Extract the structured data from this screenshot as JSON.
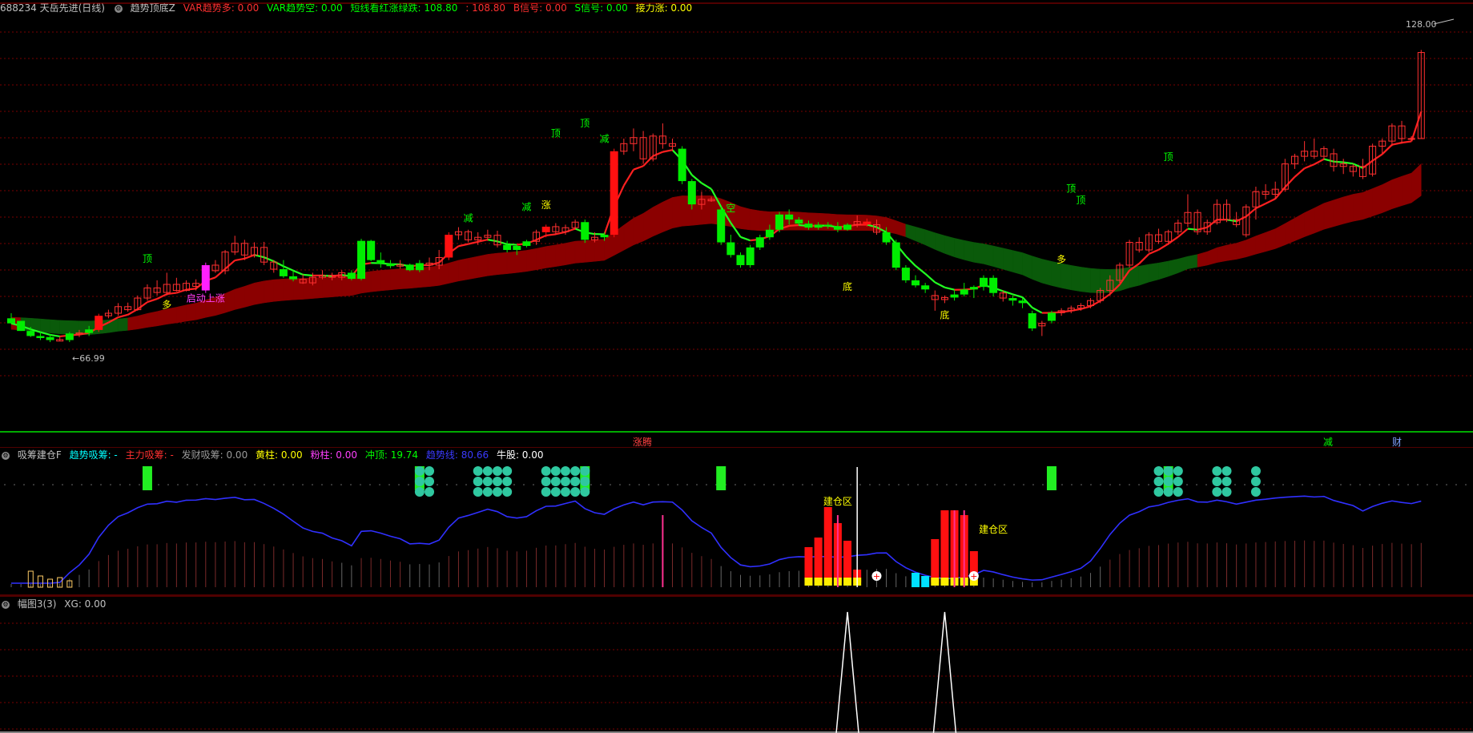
{
  "main_header": {
    "stock": "688234 天岳先进(日线)",
    "indicator": "趋势顶底Z",
    "items": [
      {
        "text": "VAR趋势多: 0.00",
        "color": "#ff3030"
      },
      {
        "text": "VAR趋势空: 0.00",
        "color": "#00ff00"
      },
      {
        "text": "短线看红涨绿跌: 108.80",
        "color": "#00ff00"
      },
      {
        "text": ": 108.80",
        "color": "#ff3030"
      },
      {
        "text": "B信号: 0.00",
        "color": "#ff3030"
      },
      {
        "text": "S信号: 0.00",
        "color": "#00ff00"
      },
      {
        "text": "接力涨: 0.00",
        "color": "#ffff00"
      }
    ]
  },
  "sub1_header": {
    "indicator": "吸筹建仓F",
    "items": [
      {
        "text": "趋势吸筹: -",
        "color": "#00ffff"
      },
      {
        "text": "主力吸筹: -",
        "color": "#ff3030"
      },
      {
        "text": "发财吸筹: 0.00",
        "color": "#9a9a9a"
      },
      {
        "text": "黄柱: 0.00",
        "color": "#ffff00"
      },
      {
        "text": "粉柱: 0.00",
        "color": "#ff40ff"
      },
      {
        "text": "冲顶: 19.74",
        "color": "#00ff00"
      },
      {
        "text": "趋势线: 80.66",
        "color": "#3a3aff"
      },
      {
        "text": "牛股: 0.00",
        "color": "#ffffff"
      }
    ]
  },
  "sub2_header": {
    "indicator": "幅图3(3)",
    "items": [
      {
        "text": "XG: 0.00",
        "color": "#c0c0c0"
      }
    ]
  },
  "chart_data": [
    {
      "type": "candlestick",
      "price_high_label": "128.00",
      "price_low_label": "66.99",
      "candles": [
        [
          71.5,
          72.5,
          70.5,
          70.5,
          "g"
        ],
        [
          71.0,
          71.0,
          69.0,
          69.0,
          "g"
        ],
        [
          69.0,
          69.8,
          67.8,
          68.0,
          "g"
        ],
        [
          68.0,
          68.8,
          67.2,
          67.6,
          "g"
        ],
        [
          67.8,
          68.4,
          66.8,
          67.2,
          "g"
        ],
        [
          67.0,
          67.8,
          66.99,
          67.3,
          "h"
        ],
        [
          67.2,
          68.8,
          66.8,
          68.5,
          "g"
        ],
        [
          68.4,
          69.2,
          67.8,
          68.6,
          "h"
        ],
        [
          68.6,
          70.0,
          68.0,
          69.3,
          "g"
        ],
        [
          69.2,
          72.4,
          68.8,
          72.0,
          "r"
        ],
        [
          72.0,
          73.2,
          71.5,
          72.5,
          "h"
        ],
        [
          72.5,
          74.5,
          72.0,
          73.8,
          "h"
        ],
        [
          73.8,
          74.6,
          72.8,
          73.2,
          "h"
        ],
        [
          73.2,
          76.0,
          73.0,
          75.5,
          "h"
        ],
        [
          75.5,
          78.2,
          75.0,
          77.5,
          "h"
        ],
        [
          77.5,
          79.0,
          76.0,
          76.6,
          "h"
        ],
        [
          76.6,
          80.5,
          76.0,
          78.2,
          "h"
        ],
        [
          78.2,
          79.5,
          76.8,
          77.0,
          "h"
        ],
        [
          77.0,
          79.0,
          76.8,
          78.4,
          "h"
        ],
        [
          78.4,
          79.2,
          77.0,
          77.8,
          "h"
        ],
        [
          77.0,
          82.5,
          76.5,
          82.0,
          "m"
        ],
        [
          82.0,
          83.0,
          80.5,
          80.9,
          "h"
        ],
        [
          80.9,
          85.0,
          80.2,
          84.6,
          "h"
        ],
        [
          84.6,
          87.8,
          84.0,
          86.3,
          "h"
        ],
        [
          86.3,
          87.0,
          83.0,
          84.0,
          "h"
        ],
        [
          84.0,
          86.5,
          83.5,
          85.5,
          "h"
        ],
        [
          85.5,
          86.6,
          82.0,
          82.6,
          "h"
        ],
        [
          82.6,
          83.0,
          80.5,
          81.2,
          "h"
        ],
        [
          81.2,
          83.0,
          79.5,
          79.8,
          "g"
        ],
        [
          79.8,
          81.0,
          78.8,
          79.2,
          "g"
        ],
        [
          79.2,
          80.2,
          78.3,
          78.5,
          "h"
        ],
        [
          78.5,
          80.5,
          78.0,
          79.6,
          "h"
        ],
        [
          79.6,
          81.0,
          79.2,
          80.0,
          "h"
        ],
        [
          80.0,
          80.5,
          79.0,
          79.6,
          "h"
        ],
        [
          79.6,
          81.0,
          79.0,
          80.5,
          "h"
        ],
        [
          80.5,
          81.0,
          79.0,
          79.3,
          "g"
        ],
        [
          79.3,
          87.2,
          79.0,
          86.8,
          "g"
        ],
        [
          86.8,
          87.0,
          82.8,
          83.0,
          "g"
        ],
        [
          83.0,
          84.5,
          81.5,
          82.3,
          "g"
        ],
        [
          82.3,
          83.0,
          81.4,
          81.8,
          "g"
        ],
        [
          81.8,
          83.0,
          81.3,
          82.1,
          "h"
        ],
        [
          82.1,
          82.3,
          80.8,
          81.0,
          "g"
        ],
        [
          81.0,
          83.0,
          80.6,
          82.4,
          "g"
        ],
        [
          82.4,
          83.5,
          81.0,
          82.0,
          "h"
        ],
        [
          82.0,
          85.0,
          81.2,
          83.5,
          "h"
        ],
        [
          83.5,
          88.5,
          83.0,
          88.0,
          "r"
        ],
        [
          88.0,
          89.5,
          87.0,
          88.6,
          "h"
        ],
        [
          88.6,
          89.0,
          86.5,
          87.0,
          "h"
        ],
        [
          87.0,
          88.5,
          86.0,
          87.5,
          "h"
        ],
        [
          87.5,
          89.0,
          86.8,
          87.9,
          "h"
        ],
        [
          87.9,
          88.8,
          85.5,
          86.0,
          "h"
        ],
        [
          86.0,
          86.8,
          84.5,
          85.0,
          "g"
        ],
        [
          85.0,
          86.0,
          84.0,
          85.8,
          "g"
        ],
        [
          85.8,
          87.0,
          85.5,
          86.7,
          "g"
        ],
        [
          86.7,
          89.0,
          86.0,
          88.5,
          "h"
        ],
        [
          88.5,
          90.0,
          87.5,
          89.6,
          "r"
        ],
        [
          89.6,
          90.3,
          88.0,
          88.6,
          "h"
        ],
        [
          88.6,
          90.0,
          88.0,
          89.4,
          "h"
        ],
        [
          89.4,
          91.0,
          89.0,
          90.5,
          "h"
        ],
        [
          90.5,
          91.0,
          86.4,
          87.0,
          "g"
        ],
        [
          87.0,
          88.5,
          86.5,
          87.5,
          "h"
        ],
        [
          87.5,
          88.5,
          86.8,
          88.0,
          "g"
        ],
        [
          88.0,
          105.0,
          87.5,
          104.5,
          "r"
        ],
        [
          104.5,
          107.0,
          103.8,
          106.0,
          "h"
        ],
        [
          106.0,
          109.0,
          104.5,
          107.2,
          "h"
        ],
        [
          107.2,
          108.5,
          102.0,
          103.0,
          "h"
        ],
        [
          103.0,
          108.0,
          102.5,
          107.5,
          "h"
        ],
        [
          107.5,
          110.0,
          105.0,
          106.0,
          "h"
        ],
        [
          106.0,
          107.0,
          104.5,
          105.5,
          "h"
        ],
        [
          105.0,
          105.5,
          98.0,
          98.6,
          "g"
        ],
        [
          98.6,
          99.0,
          93.0,
          94.0,
          "g"
        ],
        [
          94.0,
          96.5,
          93.0,
          95.0,
          "h"
        ],
        [
          95.0,
          95.5,
          94.5,
          94.7,
          "h"
        ],
        [
          93.0,
          93.5,
          86.0,
          86.5,
          "g"
        ],
        [
          86.5,
          88.0,
          83.5,
          84.0,
          "g"
        ],
        [
          84.0,
          84.5,
          81.5,
          82.0,
          "g"
        ],
        [
          82.0,
          86.0,
          81.5,
          85.5,
          "g"
        ],
        [
          85.5,
          88.0,
          85.0,
          87.5,
          "g"
        ],
        [
          87.5,
          90.0,
          87.0,
          89.0,
          "g"
        ],
        [
          89.0,
          92.5,
          88.5,
          92.0,
          "g"
        ],
        [
          92.0,
          93.0,
          90.0,
          91.0,
          "g"
        ],
        [
          91.0,
          91.5,
          89.8,
          90.2,
          "g"
        ],
        [
          90.2,
          90.8,
          89.0,
          89.4,
          "g"
        ],
        [
          89.4,
          90.5,
          89.0,
          90.0,
          "g"
        ],
        [
          90.0,
          90.5,
          89.2,
          89.7,
          "g"
        ],
        [
          89.7,
          90.5,
          88.5,
          89.0,
          "g"
        ],
        [
          89.0,
          90.3,
          88.8,
          90.0,
          "g"
        ],
        [
          90.0,
          91.8,
          89.5,
          90.6,
          "h"
        ],
        [
          90.6,
          91.2,
          89.6,
          90.0,
          "r"
        ],
        [
          90.0,
          91.0,
          88.0,
          88.5,
          "h"
        ],
        [
          88.5,
          89.5,
          86.0,
          86.5,
          "g"
        ],
        [
          86.5,
          87.0,
          81.0,
          81.5,
          "g"
        ],
        [
          81.5,
          82.0,
          78.5,
          79.0,
          "g"
        ],
        [
          79.0,
          80.0,
          77.6,
          78.0,
          "g"
        ],
        [
          78.0,
          78.5,
          76.5,
          77.2,
          "g"
        ],
        [
          76.0,
          77.0,
          73.0,
          75.2,
          "h"
        ],
        [
          75.2,
          76.0,
          74.5,
          75.6,
          "h"
        ],
        [
          75.6,
          77.0,
          75.0,
          76.2,
          "g"
        ],
        [
          76.2,
          78.5,
          75.8,
          77.2,
          "g"
        ],
        [
          77.2,
          78.0,
          75.5,
          77.7,
          "g"
        ],
        [
          77.7,
          80.0,
          77.0,
          79.5,
          "g"
        ],
        [
          79.5,
          80.0,
          75.8,
          76.5,
          "g"
        ],
        [
          76.5,
          77.0,
          74.8,
          75.5,
          "h"
        ],
        [
          75.5,
          76.0,
          74.0,
          75.0,
          "g"
        ],
        [
          75.0,
          75.5,
          73.5,
          74.5,
          "g"
        ],
        [
          72.5,
          73.0,
          69.0,
          69.5,
          "g"
        ],
        [
          70.0,
          71.0,
          68.0,
          70.5,
          "h"
        ],
        [
          71.0,
          73.0,
          70.5,
          72.6,
          "g"
        ],
        [
          72.6,
          73.5,
          72.0,
          73.0,
          "h"
        ],
        [
          73.0,
          74.0,
          72.5,
          73.5,
          "h"
        ],
        [
          73.5,
          74.5,
          73.0,
          74.0,
          "h"
        ],
        [
          74.0,
          75.5,
          73.5,
          75.0,
          "h"
        ],
        [
          75.0,
          77.5,
          74.5,
          77.0,
          "h"
        ],
        [
          77.0,
          80.0,
          76.0,
          79.0,
          "h"
        ],
        [
          79.0,
          82.5,
          78.5,
          82.0,
          "h"
        ],
        [
          82.0,
          87.0,
          81.5,
          86.5,
          "h"
        ],
        [
          86.5,
          87.5,
          84.5,
          85.0,
          "h"
        ],
        [
          85.0,
          88.5,
          84.5,
          88.0,
          "h"
        ],
        [
          88.0,
          89.2,
          86.2,
          86.7,
          "h"
        ],
        [
          86.7,
          89.0,
          86.0,
          88.6,
          "h"
        ],
        [
          88.6,
          91.0,
          88.0,
          90.3,
          "h"
        ],
        [
          90.3,
          96.0,
          89.5,
          92.4,
          "h"
        ],
        [
          92.4,
          93.0,
          88.0,
          88.6,
          "h"
        ],
        [
          88.6,
          91.0,
          88.0,
          90.4,
          "h"
        ],
        [
          90.4,
          95.0,
          90.0,
          94.0,
          "h"
        ],
        [
          94.0,
          95.0,
          90.5,
          91.0,
          "h"
        ],
        [
          91.0,
          92.5,
          89.5,
          90.0,
          "h"
        ],
        [
          88.0,
          94.0,
          87.5,
          93.5,
          "h"
        ],
        [
          93.5,
          97.5,
          91.0,
          96.5,
          "h"
        ],
        [
          96.5,
          98.0,
          95.0,
          96.0,
          "h"
        ],
        [
          96.0,
          98.5,
          95.0,
          97.0,
          "h"
        ],
        [
          97.0,
          103.0,
          96.5,
          102.0,
          "h"
        ],
        [
          102.0,
          104.0,
          101.0,
          103.5,
          "h"
        ],
        [
          103.5,
          106.5,
          102.5,
          104.5,
          "h"
        ],
        [
          104.5,
          107.0,
          103.0,
          103.5,
          "h"
        ],
        [
          103.5,
          105.5,
          102.8,
          105.0,
          "h"
        ],
        [
          104.0,
          105.0,
          100.5,
          101.5,
          "h"
        ],
        [
          101.5,
          103.0,
          100.0,
          102.0,
          "h"
        ],
        [
          100.5,
          102.0,
          99.5,
          101.5,
          "h"
        ],
        [
          101.5,
          103.0,
          99.0,
          99.5,
          "h"
        ],
        [
          100.0,
          106.0,
          99.5,
          105.5,
          "h"
        ],
        [
          105.5,
          107.0,
          104.0,
          106.5,
          "h"
        ],
        [
          106.5,
          110.0,
          105.5,
          109.5,
          "h"
        ],
        [
          109.5,
          110.5,
          106.0,
          107.0,
          "h"
        ],
        [
          107.0,
          107.5,
          106.5,
          107.0,
          "h"
        ],
        [
          107.0,
          124.5,
          107.0,
          124.0,
          "h"
        ]
      ],
      "labels": [
        {
          "text": "顶",
          "index": 14,
          "price": 82.6,
          "color": "#00ff00"
        },
        {
          "text": "多",
          "index": 16,
          "price": 73.5,
          "color": "#ffff00"
        },
        {
          "text": "启动上涨",
          "index": 20,
          "price": 74.8,
          "color": "#ff40ff"
        },
        {
          "text": "减",
          "index": 47,
          "price": 90.6,
          "color": "#00ff00"
        },
        {
          "text": "减",
          "index": 53,
          "price": 92.8,
          "color": "#00ff00"
        },
        {
          "text": "涨",
          "index": 55,
          "price": 93.2,
          "color": "#ffff00"
        },
        {
          "text": "顶",
          "index": 56,
          "price": 107.4,
          "color": "#00ff00"
        },
        {
          "text": "顶",
          "index": 59,
          "price": 109.4,
          "color": "#00ff00"
        },
        {
          "text": "减",
          "index": 61,
          "price": 106.3,
          "color": "#00ff00"
        },
        {
          "text": "空",
          "index": 74,
          "price": 92.6,
          "color": "#00ff00"
        },
        {
          "text": "底",
          "index": 86,
          "price": 77.1,
          "color": "#ffff00"
        },
        {
          "text": "底",
          "index": 96,
          "price": 71.5,
          "color": "#ffff00"
        },
        {
          "text": "顶",
          "index": 109,
          "price": 96.5,
          "color": "#00ff00"
        },
        {
          "text": "顶",
          "index": 110,
          "price": 94.2,
          "color": "#00ff00"
        },
        {
          "text": "多",
          "index": 108,
          "price": 82.5,
          "color": "#ffff00"
        },
        {
          "text": "顶",
          "index": 119,
          "price": 102.7,
          "color": "#00ff00"
        }
      ],
      "separator_labels": [
        {
          "text": "涨腾",
          "color": "#ff4040"
        },
        {
          "text": "减",
          "color": "#00ff00"
        },
        {
          "text": "财",
          "color": "#80a0ff"
        }
      ]
    },
    {
      "type": "indicator",
      "trend_line_color": "#3030ff",
      "labels": [
        {
          "text": "建仓区",
          "color": "#ffff00"
        },
        {
          "text": "建仓区",
          "color": "#ffff00"
        }
      ]
    },
    {
      "type": "line",
      "series": [
        {
          "values_peaks_at_index": [
            86,
            96
          ]
        }
      ]
    }
  ]
}
